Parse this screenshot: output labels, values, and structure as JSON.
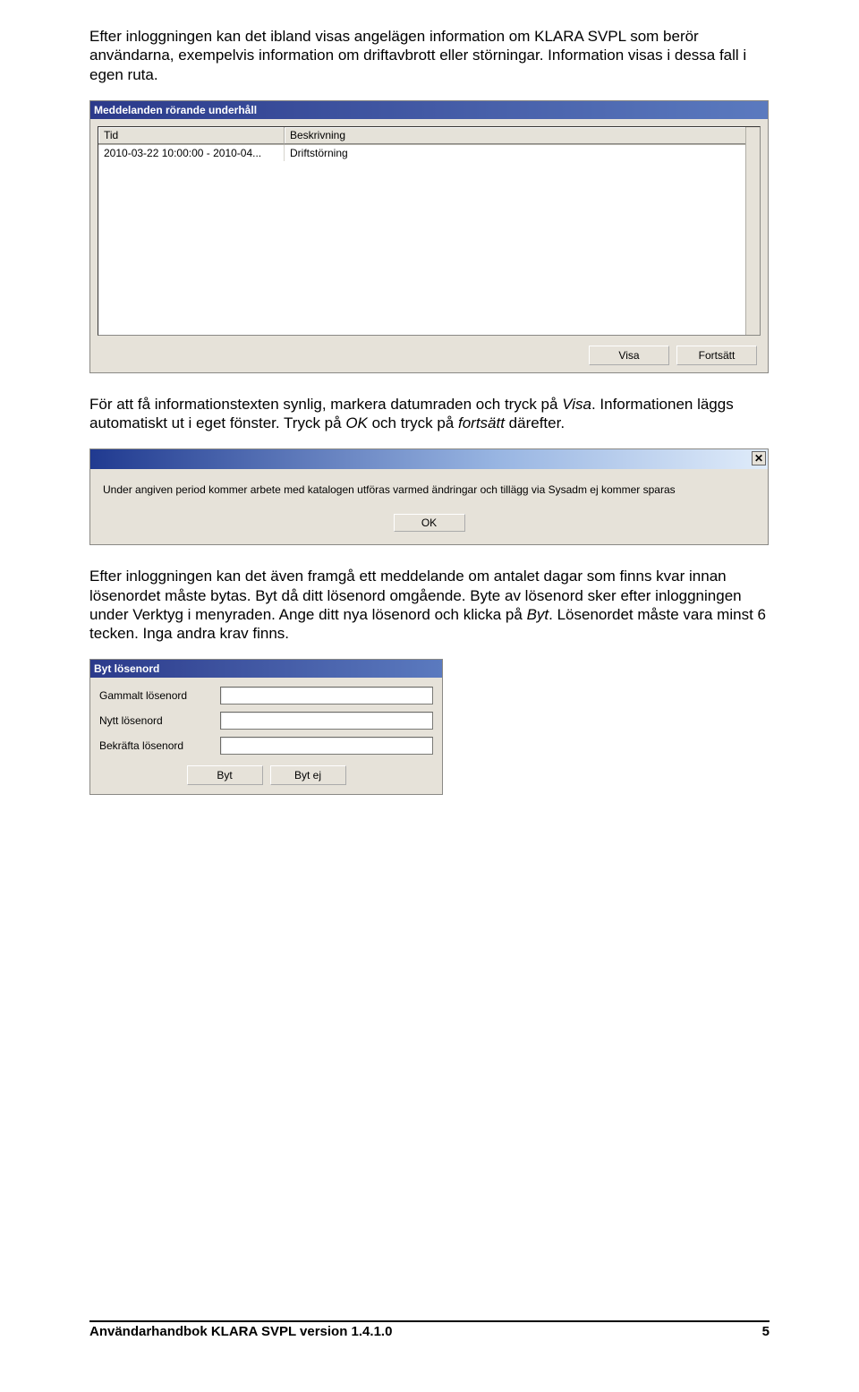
{
  "para1": "Efter inloggningen kan det ibland visas angelägen information om KLARA SVPL som berör användarna, exempelvis information om driftavbrott eller störningar. Information visas i dessa fall i egen ruta.",
  "para2_a": "För att få informationstexten synlig, markera datumraden och tryck på ",
  "para2_visa": "Visa",
  "para2_b": ". Informationen läggs automatiskt ut i eget fönster. Tryck på ",
  "para2_ok": "OK",
  "para2_c": " och tryck på ",
  "para2_fortsatt": "fortsätt",
  "para2_d": " därefter.",
  "para3_a": "Efter inloggningen kan det även framgå ett meddelande om antalet dagar som finns kvar innan lösenordet måste bytas. Byt då ditt lösenord omgående. Byte av lösenord sker efter inloggningen under Verktyg i menyraden. Ange ditt nya lösenord och klicka på ",
  "para3_byt": "Byt",
  "para3_b": ". Lösenordet måste vara minst 6 tecken. Inga andra krav finns.",
  "dialog1": {
    "title": "Meddelanden rörande underhåll",
    "columns": {
      "tid": "Tid",
      "beskrivning": "Beskrivning"
    },
    "row": {
      "tid": "2010-03-22 10:00:00 - 2010-04...",
      "beskrivning": "Driftstörning"
    },
    "visa_btn": "Visa",
    "fortsatt_btn": "Fortsätt"
  },
  "dialog2": {
    "message": "Under angiven period kommer arbete med katalogen utföras varmed ändringar och tillägg via Sysadm ej kommer sparas",
    "ok_btn": "OK"
  },
  "dialog3": {
    "title": "Byt lösenord",
    "old_label": "Gammalt lösenord",
    "new_label": "Nytt lösenord",
    "confirm_label": "Bekräfta lösenord",
    "byt_btn": "Byt",
    "bytej_btn": "Byt ej"
  },
  "footer": {
    "left": "Användarhandbok KLARA SVPL version 1.4.1.0",
    "right": "5"
  }
}
